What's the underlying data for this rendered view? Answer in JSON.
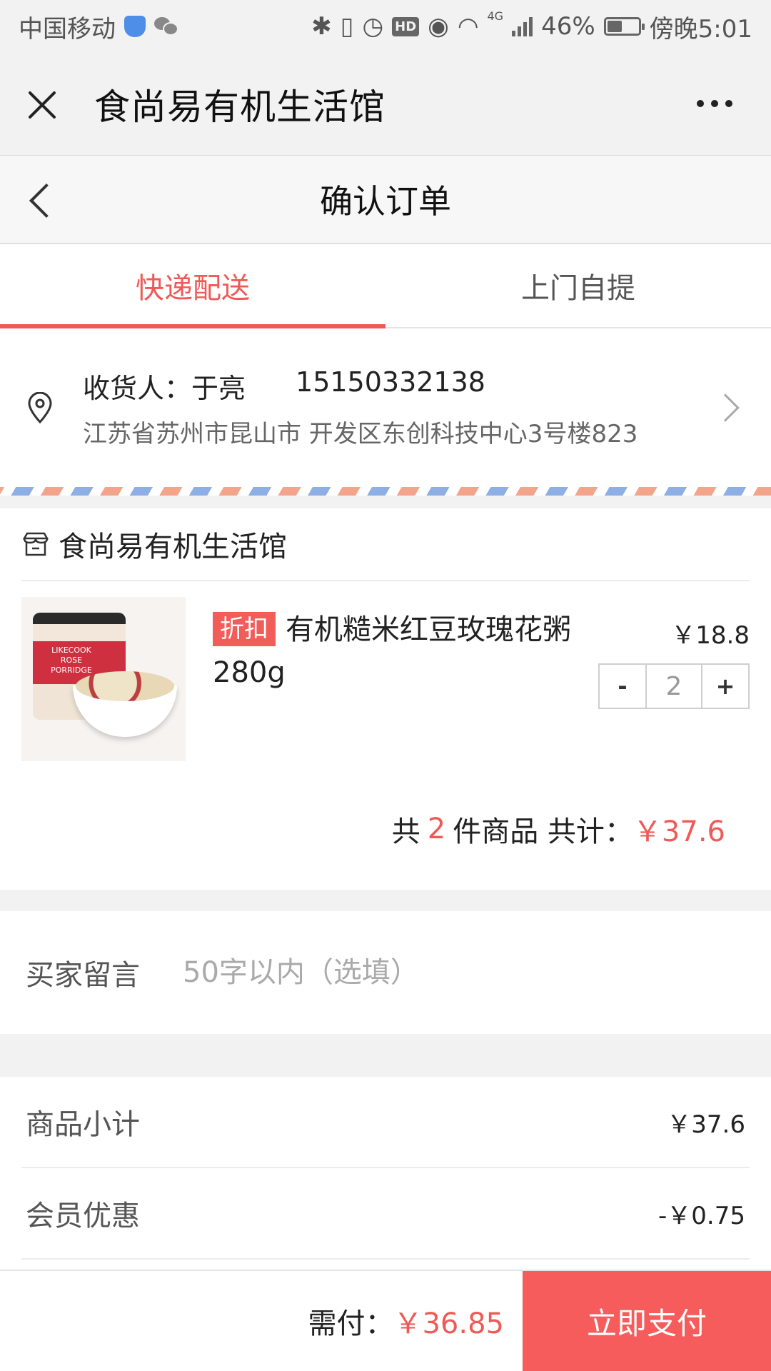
{
  "status_bar": {
    "carrier": "中国移动",
    "network": "4G",
    "battery": "46%",
    "battery_level": 0.46,
    "time": "傍晚5:01",
    "hd": "HD"
  },
  "app_header": {
    "title": "食尚易有机生活馆"
  },
  "page": {
    "title": "确认订单"
  },
  "tabs": [
    {
      "label": "快递配送",
      "active": true
    },
    {
      "label": "上门自提",
      "active": false
    }
  ],
  "address": {
    "receiver_label": "收货人：于亮",
    "phone": "15150332138",
    "detail": "江苏省苏州市昆山市 开发区东创科技中心3号楼823"
  },
  "store": {
    "name": "食尚易有机生活馆"
  },
  "product": {
    "tag": "折扣",
    "name": "有机糙米红豆玫瑰花粥280g",
    "price": "￥18.8",
    "quantity": "2",
    "minus": "-",
    "plus": "+",
    "image_brand": "LIKECOOK",
    "image_sub": "ROSE PORRIDGE"
  },
  "order_summary": {
    "prefix": "共",
    "count": "2",
    "middle": "件商品 共计：",
    "total": "￥37.6"
  },
  "message": {
    "label": "买家留言",
    "placeholder": "50字以内（选填）"
  },
  "fees": [
    {
      "label": "商品小计",
      "value": "￥37.6"
    },
    {
      "label": "会员优惠",
      "value": "-￥0.75"
    }
  ],
  "bottom_bar": {
    "pay_label": "需付：",
    "pay_amount": "￥36.85",
    "button": "立即支付"
  },
  "colors": {
    "accent": "#ee5a57",
    "pay_button": "#f65c5b"
  }
}
